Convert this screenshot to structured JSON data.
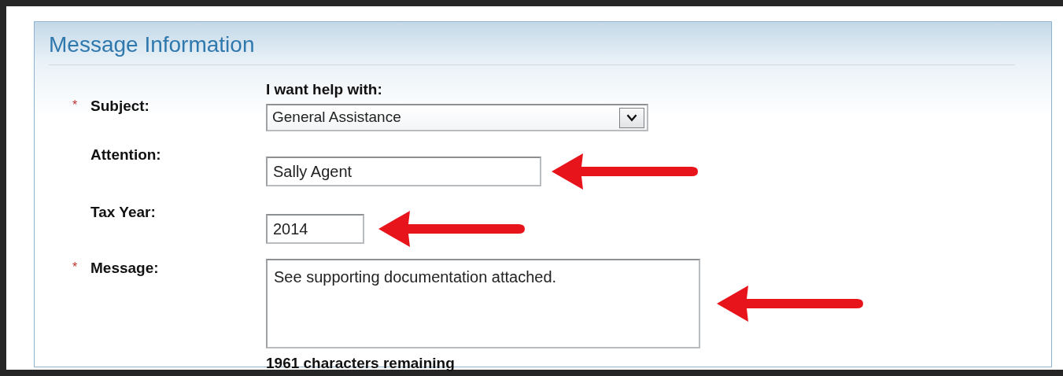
{
  "panel": {
    "title": "Message Information"
  },
  "required_marker": "*",
  "fields": [
    {
      "kind": "select",
      "label": "Subject:",
      "required": true,
      "caption": "I want help with:",
      "value": "General Assistance",
      "arrow": false
    },
    {
      "kind": "text",
      "label": "Attention:",
      "required": false,
      "value": "Sally Agent",
      "arrow": true
    },
    {
      "kind": "short_text",
      "label": "Tax Year:",
      "required": false,
      "value": "2014",
      "arrow": true
    },
    {
      "kind": "textarea",
      "label": "Message:",
      "required": true,
      "value": "See supporting documentation attached.",
      "note": "1961 characters remaining",
      "arrow": true
    }
  ]
}
